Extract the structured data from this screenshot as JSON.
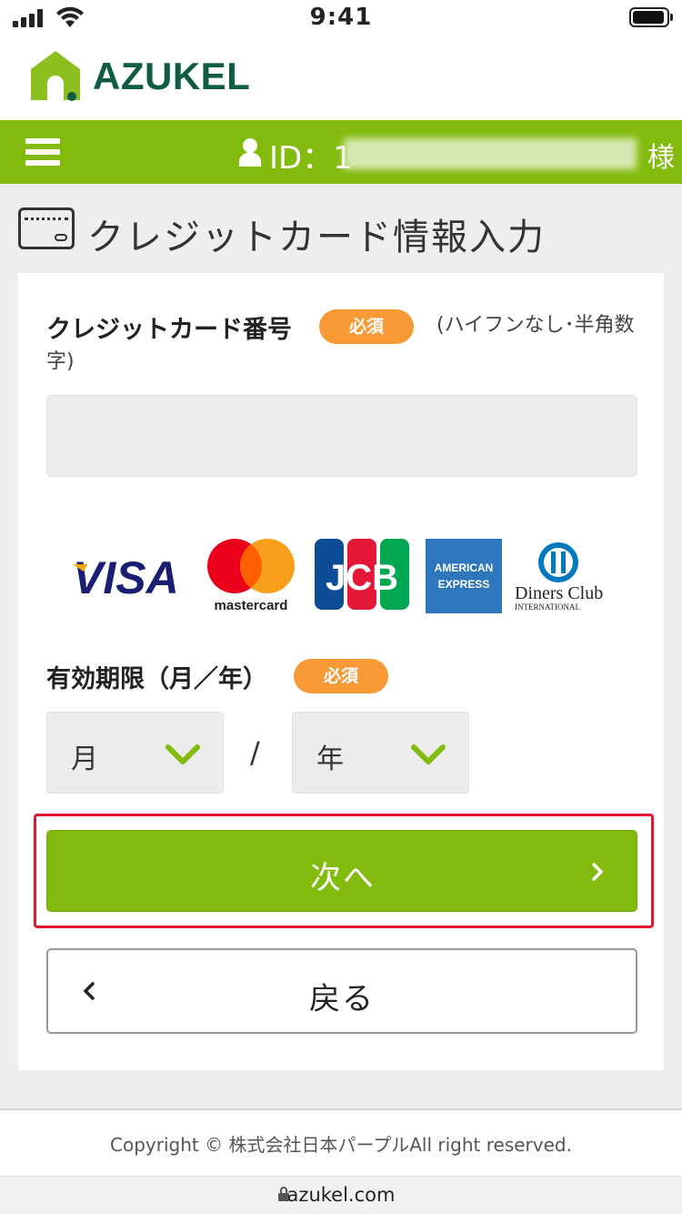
{
  "status_bar": {
    "time": "9:41"
  },
  "header": {
    "logo_text": "AZUKEL"
  },
  "nav": {
    "id_label": "ID：1",
    "honorific": "様"
  },
  "page": {
    "title": "クレジットカード情報入力"
  },
  "form": {
    "card_number": {
      "label": "クレジットカード番号",
      "required_badge": "必須",
      "hint": "(ハイフンなし･半角数字)",
      "value": ""
    },
    "brands": [
      "VISA",
      "mastercard",
      "JCB",
      "AMERICAN EXPRESS",
      "Diners Club INTERNATIONAL"
    ],
    "brand_text": {
      "visa": "VISA",
      "mastercard": "mastercard",
      "jcb": "JCB",
      "amex_1": "AMERICAN",
      "amex_2": "EXPRESS",
      "diners_1": "Diners Club",
      "diners_2": "INTERNATIONAL"
    },
    "expiry": {
      "label": "有効期限（月／年）",
      "required_badge": "必須",
      "month_value": "月",
      "separator": "/",
      "year_value": "年"
    },
    "next_label": "次へ",
    "back_label": "戻る"
  },
  "footer": {
    "copyright": "Copyright © 株式会社日本パープルAll right reserved."
  },
  "browser": {
    "url": "azukel.com"
  },
  "colors": {
    "brand_green": "#83ba0e",
    "badge_orange": "#f79a36",
    "highlight_red": "#e3152d",
    "logo_dark_green": "#0f5b44"
  }
}
